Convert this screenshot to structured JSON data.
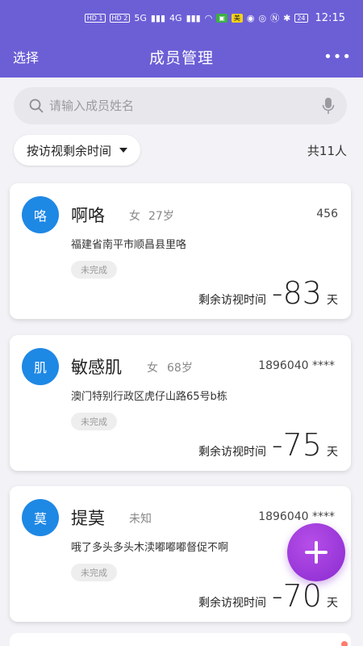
{
  "status_bar": {
    "hd1": "HD 1",
    "hd2": "HD 2",
    "net1": "5G",
    "net2": "4G",
    "battery": "24",
    "time": "12:15"
  },
  "navbar": {
    "left_label": "选择",
    "title": "成员管理",
    "more_label": "•••"
  },
  "search": {
    "placeholder": "请输入成员姓名"
  },
  "sort": {
    "label": "按访视剩余时间"
  },
  "count_label": "共11人",
  "members": [
    {
      "avatar": "咯",
      "name": "啊咯",
      "gender": "女",
      "age": "27岁",
      "phone": "456",
      "address": "福建省南平市顺昌县里咯",
      "status": "未完成",
      "remain_label": "剩余访视时间",
      "remain_days": "-83",
      "unit": "天"
    },
    {
      "avatar": "肌",
      "name": "敏感肌",
      "gender": "女",
      "age": "68岁",
      "phone": "1896040 ****",
      "address": "澳门特别行政区虎仔山路65号b栋",
      "status": "未完成",
      "remain_label": "剩余访视时间",
      "remain_days": "-75",
      "unit": "天"
    },
    {
      "avatar": "莫",
      "name": "提莫",
      "gender": "未知",
      "age": "",
      "phone": "1896040 ****",
      "address": "哦了多头多头木渎嘟嘟嘟督促不啊",
      "status": "未完成",
      "remain_label": "剩余访视时间",
      "remain_days": "-70",
      "unit": "天"
    }
  ],
  "colors": {
    "header": "#6c5fd6",
    "avatar": "#1e88e5",
    "fab": "#9b3bdc"
  }
}
